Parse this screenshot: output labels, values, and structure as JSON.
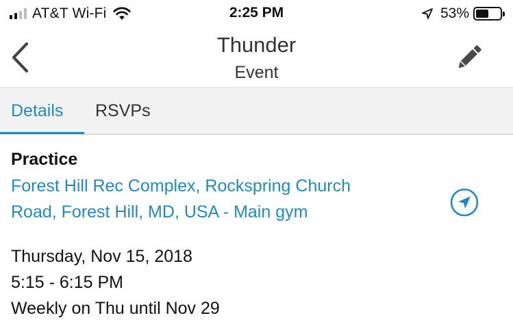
{
  "status_bar": {
    "carrier": "AT&T Wi-Fi",
    "time": "2:25 PM",
    "battery_percent": "53%",
    "battery_level": 0.53,
    "signal_bars_filled": 2,
    "signal_bars_total": 4,
    "icons": [
      "signal-bars-icon",
      "wifi-icon",
      "location-arrow-icon",
      "battery-icon"
    ]
  },
  "nav": {
    "title": "Thunder",
    "subtitle": "Event",
    "icons": [
      "chevron-left-icon",
      "pencil-icon"
    ]
  },
  "tabs": [
    {
      "label": "Details",
      "active": true
    },
    {
      "label": "RSVPs",
      "active": false
    }
  ],
  "event": {
    "type": "Practice",
    "location_line1": "Forest Hill Rec Complex, Rockspring Church",
    "location_line2": "Road, Forest Hill, MD, USA - Main gym",
    "navigate_icon": "navigation-arrow-circle-icon",
    "date": "Thursday, Nov 15, 2018",
    "time": "5:15 - 6:15 PM",
    "recurrence": "Weekly on Thu until Nov 29"
  },
  "colors": {
    "accent": "#1e8ac3",
    "tab_bar_bg": "#f2f2f2",
    "text": "#111111",
    "nav_text": "#333333"
  }
}
